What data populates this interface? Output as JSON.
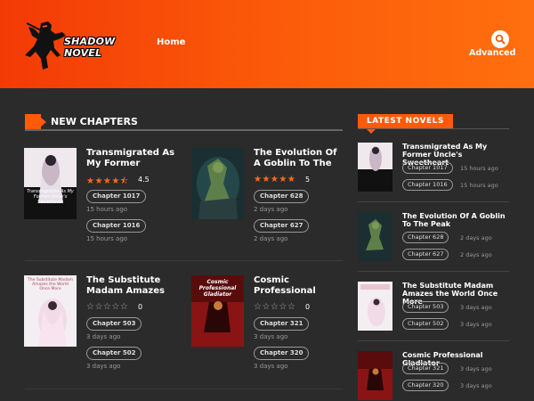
{
  "header": {
    "logo_text": "SHADOW NOVEL",
    "nav_home": "Home",
    "advanced": "Advanced",
    "accent": "#ff5a0a"
  },
  "new_chapters": {
    "title": "NEW CHAPTERS",
    "cards": [
      {
        "title": "Transmigrated As My Former Uncle`s...",
        "stars_filled": 4.5,
        "rating": "4.5",
        "chapters": [
          "Chapter 1017",
          "Chapter 1016"
        ],
        "times": [
          "15 hours ago",
          "15 hours ago"
        ],
        "cover_text": "Transmigrated As My Former Uncle's Sweetheart"
      },
      {
        "title": "The Evolution Of A Goblin To The Peak",
        "stars_filled": 5,
        "rating": "5",
        "chapters": [
          "Chapter 628",
          "Chapter 627"
        ],
        "times": [
          "2 days ago",
          "2 days ago"
        ]
      },
      {
        "title": "The Substitute Madam Amazes th...",
        "stars_filled": 0,
        "rating": "0",
        "chapters": [
          "Chapter 503",
          "Chapter 502"
        ],
        "times": [
          "3 days ago",
          "3 days ago"
        ],
        "cover_text": "The Substitute Madam Amazes the World Once More"
      },
      {
        "title": "Cosmic Professional Gladiator",
        "stars_filled": 0,
        "rating": "0",
        "chapters": [
          "Chapter 321",
          "Chapter 320"
        ],
        "times": [
          "3 days ago",
          "3 days ago"
        ],
        "cover_text": "Cosmic Professional Gladiator"
      }
    ]
  },
  "latest_novels": {
    "title": "LATEST NOVELS",
    "items": [
      {
        "title": "Transmigrated As My Former Uncle's Sweetheart",
        "chapters": [
          "Chapter 1017",
          "Chapter 1016"
        ],
        "times": [
          "15 hours ago",
          "15 hours ago"
        ]
      },
      {
        "title": "The Evolution Of A Goblin To The Peak",
        "chapters": [
          "Chapter 628",
          "Chapter 627"
        ],
        "times": [
          "2 days ago",
          "2 days ago"
        ]
      },
      {
        "title": "The Substitute Madam Amazes the World Once More",
        "chapters": [
          "Chapter 503",
          "Chapter 502"
        ],
        "times": [
          "3 days ago",
          "3 days ago"
        ]
      },
      {
        "title": "Cosmic Professional Gladiator",
        "chapters": [
          "Chapter 321",
          "Chapter 320"
        ],
        "times": [
          "3 days ago",
          "3 days ago"
        ]
      }
    ]
  }
}
